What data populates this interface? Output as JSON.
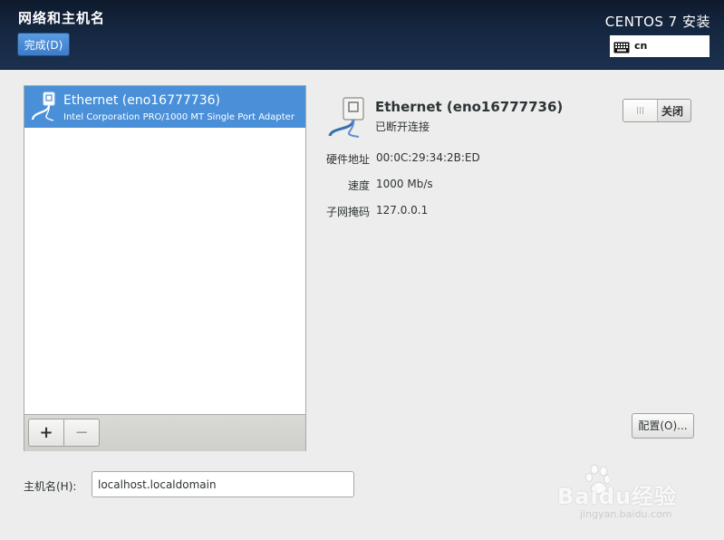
{
  "header": {
    "spoke_title": "网络和主机名",
    "done_button": "完成(D)",
    "install_title": "CENTOS 7 安装",
    "keyboard_layout": "cn"
  },
  "device_list": {
    "items": [
      {
        "name": "Ethernet (eno16777736)",
        "description": "Intel Corporation PRO/1000 MT Single Port Adapter",
        "icon": "ethernet-cable-icon",
        "selected": true
      }
    ],
    "add_label": "+",
    "remove_label": "−"
  },
  "details": {
    "name": "Ethernet (eno16777736)",
    "status": "已断开连接",
    "toggle_label": "关闭",
    "toggle_on": false,
    "properties": [
      {
        "label": "硬件地址",
        "value": "00:0C:29:34:2B:ED"
      },
      {
        "label": "速度",
        "value": "1000 Mb/s"
      },
      {
        "label": "子网掩码",
        "value": "127.0.0.1"
      }
    ],
    "configure_button": "配置(O)..."
  },
  "hostname": {
    "label": "主机名(H):",
    "value": "localhost.localdomain"
  },
  "watermark": {
    "text": "Baidu经验",
    "url": "jingyan.baidu.com"
  },
  "colors": {
    "header_bg": "#14263f",
    "selection": "#4a90d9",
    "button_blue": "#3d7cc9",
    "background": "#ededed"
  }
}
